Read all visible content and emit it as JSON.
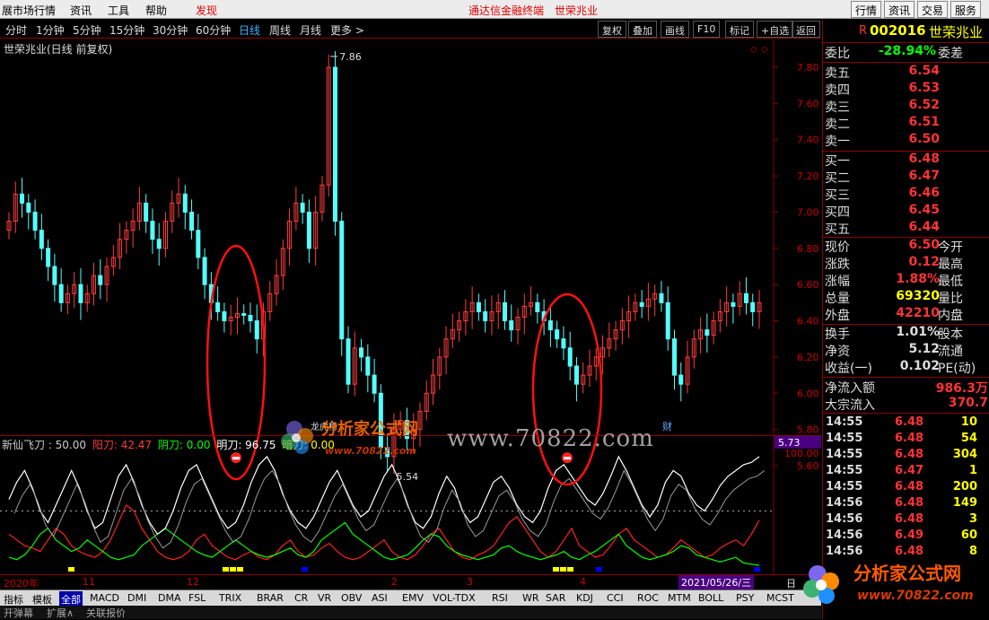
{
  "menu": {
    "item1": "展市场行情",
    "item2": "资讯",
    "item3": "工具",
    "item4": "帮助",
    "item5": "发现",
    "center": "通达信金融终端　世荣兆业",
    "btn1": "行情",
    "btn2": "资讯",
    "btn3": "交易",
    "btn4": "服务"
  },
  "periods": [
    "分时",
    "1分钟",
    "5分钟",
    "15分钟",
    "30分钟",
    "60分钟",
    "日线",
    "周线",
    "月线",
    "更多 >"
  ],
  "active_period": "日线",
  "toolbar": [
    "复权",
    "叠加",
    "画线",
    "F10",
    "标记",
    "+自选",
    "返回"
  ],
  "chart_title": "世荣兆业(日线 前复权)",
  "price_axis": [
    "7.80",
    "7.60",
    "7.40",
    "7.20",
    "7.00",
    "6.80",
    "6.60",
    "6.40",
    "6.20",
    "6.00",
    "5.80",
    "5.60"
  ],
  "high_label": "7.86",
  "low_label": "5.54",
  "current_box": "5.73",
  "markers": {
    "m1": "财",
    "m2": "龙虎榜"
  },
  "indicator": {
    "name": "新仙飞刀 : 50.00",
    "yang": "阳刀: 42.47",
    "yin": "阴刀: 0.00",
    "ming": "明刀: 96.75",
    "an": "暗刀: 0.00"
  },
  "ind_axis": {
    "top": "100.00",
    "mid": "50.00"
  },
  "watermark": {
    "line1": "分析家公式网",
    "line2": "www.70822.com",
    "url": "www.70822.com"
  },
  "xaxis": [
    "2020年",
    "11",
    "12",
    "2",
    "3",
    "4"
  ],
  "date_box": "2021/05/26/三",
  "date_suffix": "日",
  "tabs": [
    "指标",
    "模板",
    "全部",
    "MACD",
    "DMI",
    "DMA",
    "FSL",
    "TRIX",
    "BRAR",
    "CR",
    "VR",
    "OBV",
    "ASI",
    "EMV",
    "VOL-TDX",
    "RSI",
    "WR",
    "SAR",
    "KDJ",
    "CCI",
    "ROC",
    "MTM",
    "BOLL",
    "PSY",
    "MCST"
  ],
  "bottom": [
    "开弹幕",
    "扩展∧",
    "关联报价"
  ],
  "stock": {
    "code": "002016",
    "name": "世荣兆业",
    "flag": "R"
  },
  "weibi": {
    "label": "委比",
    "value": "-28.94%",
    "label2": "委差"
  },
  "asks": [
    {
      "label": "卖五",
      "price": "6.54"
    },
    {
      "label": "卖四",
      "price": "6.53"
    },
    {
      "label": "卖三",
      "price": "6.52"
    },
    {
      "label": "卖二",
      "price": "6.51"
    },
    {
      "label": "卖一",
      "price": "6.50"
    }
  ],
  "bids": [
    {
      "label": "买一",
      "price": "6.48"
    },
    {
      "label": "买二",
      "price": "6.47"
    },
    {
      "label": "买三",
      "price": "6.46"
    },
    {
      "label": "买四",
      "price": "6.45"
    },
    {
      "label": "买五",
      "price": "6.44"
    }
  ],
  "quote": [
    {
      "l": "现价",
      "v": "6.50",
      "r": "今开"
    },
    {
      "l": "涨跌",
      "v": "0.12",
      "r": "最高"
    },
    {
      "l": "涨幅",
      "v": "1.88%",
      "r": "最低"
    },
    {
      "l": "总量",
      "v": "69320",
      "r": "量比"
    },
    {
      "l": "外盘",
      "v": "42210",
      "r": "内盘"
    }
  ],
  "quote2": [
    {
      "l": "换手",
      "v": "1.01%",
      "r": "股本"
    },
    {
      "l": "净资",
      "v": "5.12",
      "r": "流通"
    },
    {
      "l": "收益(一)",
      "v": "0.102",
      "r": "PE(动)"
    }
  ],
  "flow": [
    {
      "l": "净流入额",
      "v": "986.3万"
    },
    {
      "l": "大宗流入",
      "v": "370.7"
    }
  ],
  "trades": [
    {
      "t": "14:55",
      "p": "6.48",
      "v": "10"
    },
    {
      "t": "14:55",
      "p": "6.48",
      "v": "54"
    },
    {
      "t": "14:55",
      "p": "6.48",
      "v": "304"
    },
    {
      "t": "14:55",
      "p": "6.47",
      "v": "1"
    },
    {
      "t": "14:55",
      "p": "6.48",
      "v": "200"
    },
    {
      "t": "14:56",
      "p": "6.48",
      "v": "149"
    },
    {
      "t": "14:56",
      "p": "6.48",
      "v": "3"
    },
    {
      "t": "14:56",
      "p": "6.49",
      "v": "60"
    },
    {
      "t": "14:56",
      "p": "6.48",
      "v": "8"
    }
  ],
  "colors": {
    "up": "#ff3c3c",
    "down": "#54ffff",
    "yang": "#ff2020",
    "yin": "#00ff00",
    "ming": "#ffffff",
    "an": "#ffff00",
    "accent": "#e00000"
  },
  "chart_data": {
    "type": "candlestick",
    "ylim": [
      5.5,
      7.9
    ],
    "closes": [
      6.95,
      7.1,
      7.05,
      7.0,
      6.9,
      6.8,
      6.7,
      6.6,
      6.5,
      6.55,
      6.6,
      6.5,
      6.55,
      6.65,
      6.6,
      6.7,
      6.75,
      6.85,
      6.9,
      6.95,
      7.05,
      6.95,
      6.85,
      6.8,
      6.95,
      7.05,
      7.1,
      7.0,
      6.9,
      6.75,
      6.6,
      6.5,
      6.45,
      6.4,
      6.42,
      6.44,
      6.43,
      6.4,
      6.3,
      6.45,
      6.55,
      6.65,
      6.8,
      6.95,
      7.05,
      7.0,
      6.8,
      7.0,
      7.15,
      7.8,
      6.95,
      6.3,
      6.05,
      6.25,
      6.2,
      6.1,
      6.0,
      5.7,
      5.65,
      5.8,
      5.85,
      5.75,
      5.8,
      5.9,
      6.0,
      6.1,
      6.2,
      6.3,
      6.35,
      6.4,
      6.45,
      6.5,
      6.45,
      6.4,
      6.45,
      6.5,
      6.4,
      6.35,
      6.42,
      6.48,
      6.5,
      6.45,
      6.4,
      6.35,
      6.3,
      6.25,
      6.15,
      6.05,
      6.1,
      6.15,
      6.2,
      6.25,
      6.3,
      6.35,
      6.4,
      6.45,
      6.5,
      6.48,
      6.52,
      6.55,
      6.5,
      6.3,
      6.1,
      6.05,
      6.2,
      6.3,
      6.35,
      6.32,
      6.4,
      6.45,
      6.5,
      6.48,
      6.55,
      6.5,
      6.45,
      6.5
    ],
    "indicator_series": [
      {
        "name": "阳刀",
        "values": [
          30,
          25,
          20,
          18,
          15,
          25,
          35,
          30,
          20,
          15,
          12,
          10,
          15,
          25,
          40,
          55,
          50,
          35,
          25,
          15,
          10,
          8,
          10,
          15,
          25,
          30,
          20,
          15,
          10,
          8,
          12,
          15,
          10,
          8,
          12,
          20,
          25,
          15,
          10,
          12,
          18,
          22,
          15,
          10,
          8,
          10,
          15,
          20,
          25,
          15,
          10,
          8,
          12,
          20,
          30,
          35,
          25,
          15,
          10,
          8,
          12,
          15,
          20,
          30,
          40,
          45,
          35,
          25,
          15,
          10,
          15,
          25,
          35,
          20,
          15,
          10,
          12,
          20,
          30,
          35,
          25,
          20,
          15,
          10,
          12,
          18,
          25,
          20,
          15,
          10,
          12,
          18,
          22,
          25,
          20,
          30,
          42
        ]
      },
      {
        "name": "阴刀",
        "values": [
          10,
          8,
          12,
          20,
          30,
          35,
          25,
          20,
          15,
          18,
          25,
          20,
          15,
          10,
          8,
          10,
          12,
          20,
          25,
          30,
          35,
          30,
          25,
          20,
          15,
          12,
          10,
          15,
          20,
          25,
          20,
          15,
          12,
          10,
          12,
          15,
          18,
          12,
          10,
          15,
          25,
          30,
          35,
          40,
          30,
          25,
          20,
          15,
          10,
          8,
          10,
          12,
          18,
          25,
          30,
          28,
          20,
          15,
          12,
          10,
          8,
          10,
          12,
          18,
          20,
          15,
          12,
          10,
          8,
          10,
          12,
          15,
          10,
          8,
          12,
          15,
          20,
          25,
          30,
          20,
          15,
          10,
          8,
          10,
          12,
          15,
          20,
          18,
          12,
          10,
          8,
          6,
          8,
          10,
          5,
          4,
          3
        ]
      },
      {
        "name": "明刀",
        "values": [
          60,
          75,
          85,
          70,
          50,
          40,
          55,
          70,
          85,
          70,
          50,
          35,
          40,
          60,
          80,
          90,
          75,
          55,
          40,
          30,
          35,
          50,
          70,
          85,
          90,
          75,
          60,
          45,
          35,
          40,
          55,
          75,
          90,
          97,
          85,
          65,
          50,
          40,
          35,
          45,
          60,
          75,
          85,
          70,
          55,
          45,
          50,
          65,
          80,
          90,
          75,
          55,
          40,
          35,
          45,
          65,
          80,
          70,
          50,
          40,
          45,
          60,
          75,
          80,
          70,
          55,
          45,
          40,
          50,
          70,
          85,
          90,
          80,
          70,
          60,
          55,
          65,
          80,
          97,
          85,
          70,
          55,
          45,
          55,
          75,
          85,
          80,
          65,
          55,
          50,
          60,
          72,
          80,
          85,
          90,
          92,
          97
        ]
      }
    ]
  }
}
